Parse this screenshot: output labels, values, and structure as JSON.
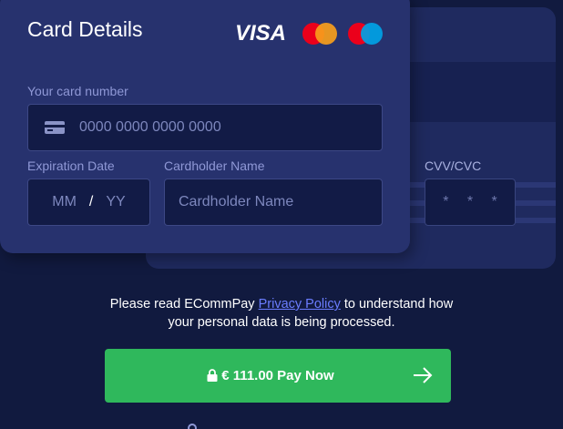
{
  "card": {
    "title": "Card Details",
    "brands": [
      "VISA",
      "mastercard",
      "maestro"
    ],
    "card_number": {
      "label": "Your card number",
      "placeholder": "0000 0000 0000 0000"
    },
    "expiration": {
      "label": "Expiration Date",
      "month_placeholder": "MM",
      "separator": "/",
      "year_placeholder": "YY"
    },
    "cardholder": {
      "label": "Cardholder Name",
      "placeholder": "Cardholder Name"
    },
    "cvv": {
      "label": "CVV/CVC",
      "placeholder": "* * *"
    }
  },
  "consent": {
    "text_before": "Please read ECommPay ",
    "link_text": "Privacy Policy",
    "text_after_line1": " to understand how",
    "text_line2": "your personal data is being processed."
  },
  "pay_button": {
    "label": "€ 111.00 Pay Now"
  },
  "colors": {
    "background": "#111a3f",
    "card_front": "#27326e",
    "card_back": "#1f2a5f",
    "pay_green": "#2fb85c",
    "link": "#6b7dff",
    "mc_red": "#eb001b",
    "mc_orange": "#f79e1b",
    "maestro_blue": "#00a2e5"
  },
  "icons": [
    "credit-card-icon",
    "lock-icon",
    "arrow-right-icon"
  ]
}
